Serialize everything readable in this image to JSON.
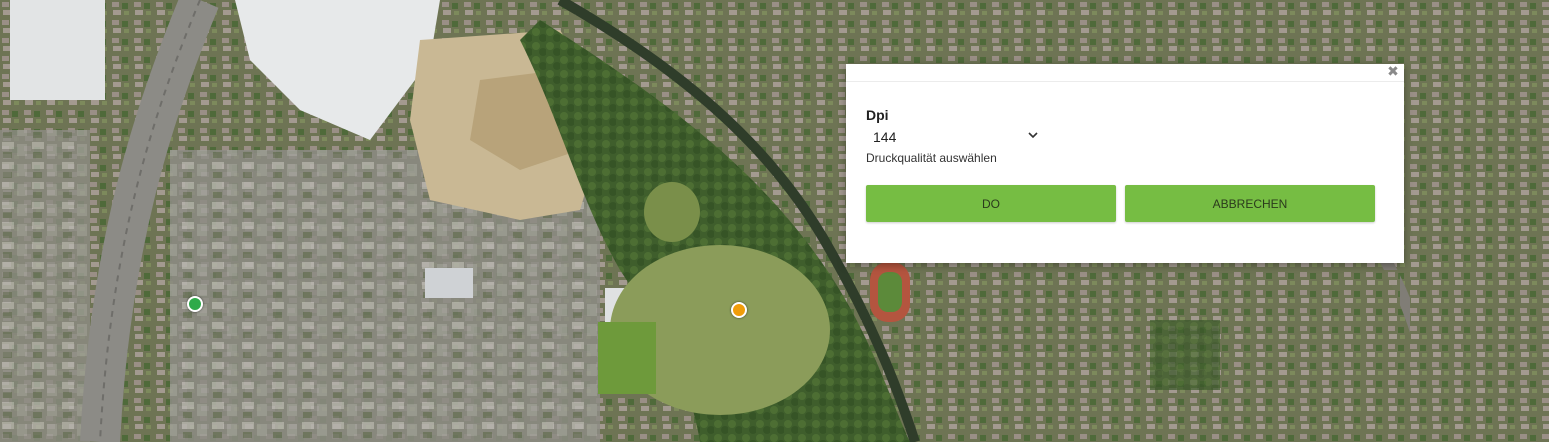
{
  "map": {
    "markers": [
      {
        "name": "marker-green",
        "color": "#2faa4a"
      },
      {
        "name": "marker-orange",
        "color": "#f09d0a"
      }
    ]
  },
  "dialog": {
    "close_icon": "close-icon",
    "field_label": "Dpi",
    "dpi_value": "144",
    "hint": "Druckqualität auswählen",
    "ok_label": "DO",
    "cancel_label": "ABBRECHEN",
    "button_color": "#76bd43"
  }
}
